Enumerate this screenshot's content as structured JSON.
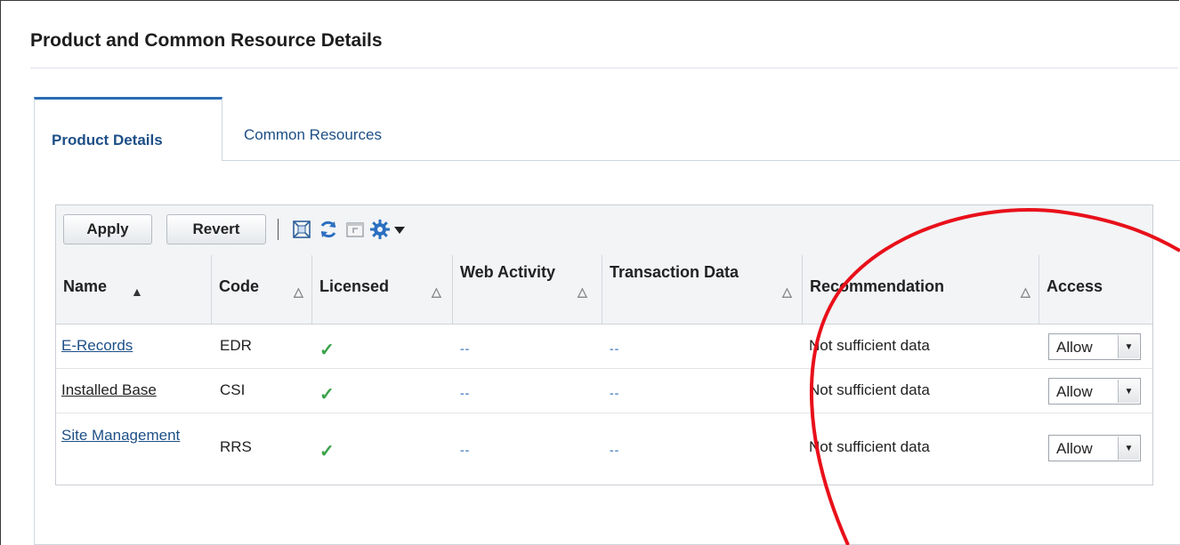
{
  "page": {
    "title": "Product and Common Resource Details"
  },
  "tabs": [
    {
      "label": "Product Details",
      "active": true
    },
    {
      "label": "Common Resources",
      "active": false
    }
  ],
  "toolbar": {
    "apply_label": "Apply",
    "revert_label": "Revert",
    "icons": [
      "detach-icon",
      "refresh-icon",
      "restore-icon",
      "gear-icon",
      "dropdown-arrow-icon"
    ]
  },
  "table": {
    "columns": {
      "name": "Name",
      "code": "Code",
      "licensed": "Licensed",
      "web_activity": "Web Activity",
      "transaction_data": "Transaction Data",
      "recommendation": "Recommendation",
      "access": "Access"
    },
    "rows": [
      {
        "name": "E-Records",
        "name_is_link": true,
        "code": "EDR",
        "licensed": "✓",
        "web_activity": "--",
        "transaction_data": "--",
        "recommendation": "Not sufficient data",
        "access": "Allow"
      },
      {
        "name": "Installed Base",
        "name_is_link": false,
        "code": "CSI",
        "licensed": "✓",
        "web_activity": "--",
        "transaction_data": "--",
        "recommendation": "Not sufficient data",
        "access": "Allow"
      },
      {
        "name": "Site Management",
        "name_is_link": true,
        "code": "RRS",
        "licensed": "✓",
        "web_activity": "--",
        "transaction_data": "--",
        "recommendation": "Not sufficient data",
        "access": "Allow"
      }
    ]
  },
  "colors": {
    "annotation_circle": "#e8101a",
    "link": "#1d4f87",
    "tab_accent": "#2a6db4",
    "check": "#3aa24a"
  }
}
